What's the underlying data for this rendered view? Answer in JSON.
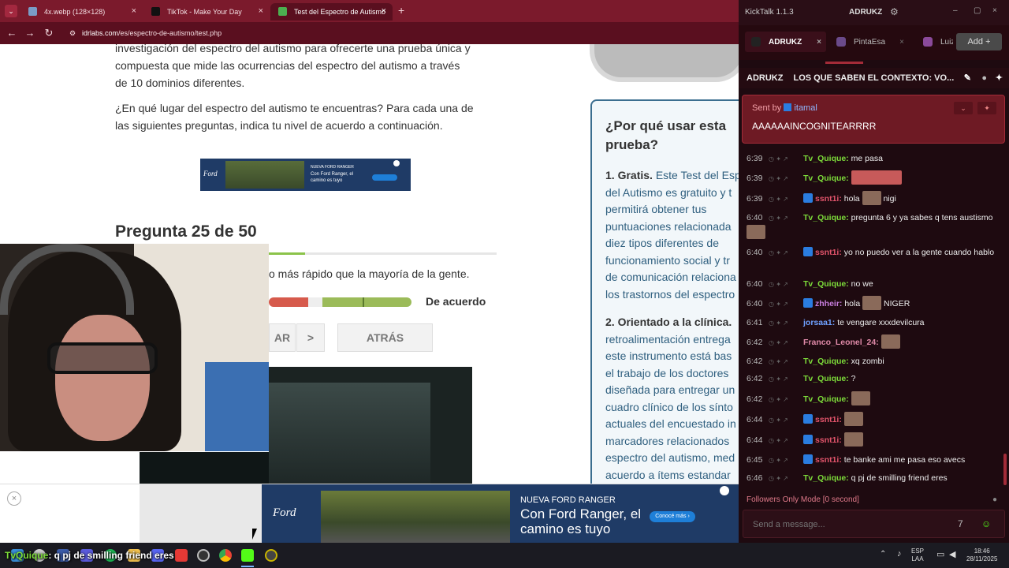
{
  "browser": {
    "tabs": [
      {
        "label": "4x.webp (128×128)",
        "favicon_color": "#7a9cc6"
      },
      {
        "label": "TikTok - Make Your Day",
        "favicon_color": "#111111"
      },
      {
        "label": "Test del Espectro de Autismo",
        "favicon_color": "#4caf50"
      }
    ],
    "new_tab": "+",
    "close": "×",
    "url_host": "idrlabs.com",
    "url_path": "/es/espectro-de-autismo/test.php"
  },
  "page": {
    "intro_lines": [
      "investigación del espectro del autismo para ofrecerte una prueba única y",
      "compuesta que mide las ocurrencias del espectro del autismo a través",
      "de 10 dominios diferentes."
    ],
    "prompt_lines": [
      "¿En qué lugar del espectro del autismo te encuentras? Para cada una de",
      "las siguientes preguntas, indica tu nivel de acuerdo a continuación."
    ],
    "question_label": "Pregunta 25 de 50",
    "progress_fraction": 0.16,
    "question_text": "o más rápido que la mayoría de la gente.",
    "agree_label": "De acuerdo",
    "next_partial": "AR",
    "next_arrow": ">",
    "back_label": "ATRÁS",
    "sidebox": {
      "title": "¿Por qué usar esta prueba?",
      "p1_bold": "1. Gratis.",
      "p1_lines": [
        "Este Test del Esp",
        "del Autismo es gratuito y t",
        "permitirá obtener tus",
        "puntuaciones relacionada",
        "diez tipos diferentes de",
        "funcionamiento social y tr",
        "de comunicación relaciona",
        "los trastornos del espectro"
      ],
      "p2_bold": "2. Orientado a la clínica.",
      "p2_lines": [
        "retroalimentación entrega",
        "este instrumento está bas",
        "el trabajo de los doctores",
        "diseñada para entregar un",
        "cuadro clínico de los sínto",
        "actuales del encuestado in",
        "marcadores relacionados",
        "espectro del autismo, med",
        "acuerdo a ítems estandar"
      ]
    },
    "ad_small": {
      "brand": "Ford",
      "line1": "NUEVA FORD RANGER",
      "line2": "Con Ford Ranger, el camino es tuyo",
      "cta": "Conocé más"
    },
    "ad_big": {
      "brand": "Ford",
      "line1": "NUEVA FORD RANGER",
      "line2": "Con Ford Ranger, el camino es tuyo",
      "cta": "Conocé más ›"
    },
    "ad_close": "×"
  },
  "kicktalk": {
    "app_title": "KickTalk 1.1.3",
    "user": "ADRUKZ",
    "tabs": [
      {
        "label": "ADRUKZ",
        "active": true
      },
      {
        "label": "PintaEsa",
        "active": false
      },
      {
        "label": "Luiz",
        "active": false
      }
    ],
    "add_button": "Add +",
    "stream_channel": "ADRUKZ",
    "stream_title": "LOS QUE SABEN EL CONTEXTO: VO...",
    "pinned": {
      "sent_by": "Sent by",
      "user": "itamal",
      "message": "AAAAAAINCOGNITEARRRR"
    },
    "messages": [
      {
        "time": "6:39",
        "user": "Tv_Quique:",
        "color": "green",
        "text": "me pasa",
        "emote": false
      },
      {
        "time": "6:39",
        "user": "Tv_Quique:",
        "color": "green",
        "text": "",
        "emote": "wide"
      },
      {
        "time": "6:39",
        "user": "ssnt1i:",
        "color": "red",
        "text": "hola",
        "emote": "small",
        "after": "nigi"
      },
      {
        "time": "6:40",
        "user": "Tv_Quique:",
        "color": "green",
        "text": "pregunta 6 y ya sabes q tens austismo",
        "emote": "small"
      },
      {
        "time": "6:40",
        "user": "ssnt1i:",
        "color": "red",
        "text": "yo no puedo ver a la gente cuando hablo",
        "emote": false
      },
      {
        "time": "6:40",
        "user": "Tv_Quique:",
        "color": "green",
        "text": "no we",
        "emote": false
      },
      {
        "time": "6:40",
        "user": "zhheir:",
        "color": "purple",
        "text": "hola",
        "emote": "small",
        "after": "NIGER"
      },
      {
        "time": "6:41",
        "user": "jorsaa1:",
        "color": "blue",
        "text": "te vengare xxxdevilcura",
        "emote": false
      },
      {
        "time": "6:42",
        "user": "Franco_Leonel_24:",
        "color": "pink",
        "text": "",
        "emote": "small"
      },
      {
        "time": "6:42",
        "user": "Tv_Quique:",
        "color": "green",
        "text": "xq zombi",
        "emote": false
      },
      {
        "time": "6:42",
        "user": "Tv_Quique:",
        "color": "green",
        "text": "?",
        "emote": false
      },
      {
        "time": "6:42",
        "user": "Tv_Quique:",
        "color": "green",
        "text": "",
        "emote": "small"
      },
      {
        "time": "6:44",
        "user": "ssnt1i:",
        "color": "red",
        "text": "",
        "emote": "small"
      },
      {
        "time": "6:44",
        "user": "ssnt1i:",
        "color": "red",
        "text": "",
        "emote": "small"
      },
      {
        "time": "6:45",
        "user": "ssnt1i:",
        "color": "red",
        "text": "te banke ami me pasa eso avecs",
        "emote": false
      },
      {
        "time": "6:46",
        "user": "Tv_Quique:",
        "color": "green",
        "text": "q pj de smilling friend eres",
        "emote": false
      }
    ],
    "followers_mode": "Followers Only Mode [0 second]",
    "input_placeholder": "Send a message..."
  },
  "overlay": {
    "name": "TvQuique",
    "text": ": q pj de smilling friend eres"
  },
  "taskbar": {
    "lang_top": "ESP",
    "lang_bottom": "LAA",
    "time": "18:46",
    "date": "28/11/2025"
  }
}
